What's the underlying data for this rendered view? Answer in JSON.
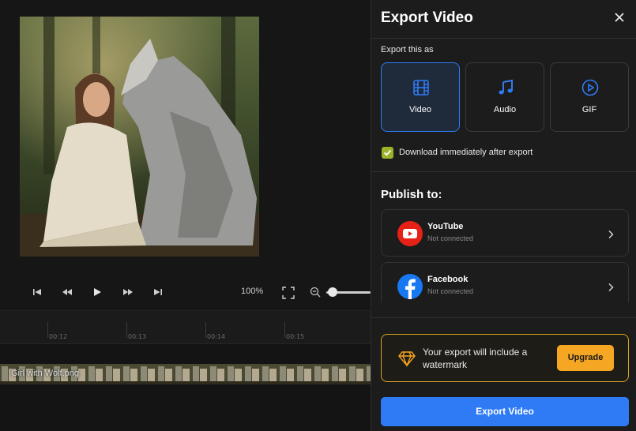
{
  "editor": {
    "preview_alt": "Girl with Wolf",
    "zoom_percent": "100%",
    "zoom_slider_level": 0.05,
    "ruler_labels": [
      "00:12",
      "00:13",
      "00:14",
      "00:15"
    ],
    "clip_name": "Girl with Wolf.png"
  },
  "export_panel": {
    "title": "Export Video",
    "export_as_label": "Export this as",
    "formats": [
      {
        "label": "Video",
        "icon": "film-icon",
        "selected": true
      },
      {
        "label": "Audio",
        "icon": "music-note-icon",
        "selected": false
      },
      {
        "label": "GIF",
        "icon": "play-circle-icon",
        "selected": false
      }
    ],
    "download_checkbox": {
      "label": "Download immediately after export",
      "checked": true
    },
    "publish_title": "Publish to:",
    "publish_targets": [
      {
        "name": "YouTube",
        "status": "Not connected",
        "icon": "youtube-icon"
      },
      {
        "name": "Facebook",
        "status": "Not connected",
        "icon": "facebook-icon"
      }
    ],
    "watermark_notice": "Your export will include a watermark",
    "upgrade_label": "Upgrade",
    "export_button_label": "Export Video"
  },
  "colors": {
    "accent_blue": "#2f7bf5",
    "upgrade_orange": "#f5a623",
    "checkbox_green": "#9ab32a",
    "panel_bg": "#1c1c1c"
  }
}
